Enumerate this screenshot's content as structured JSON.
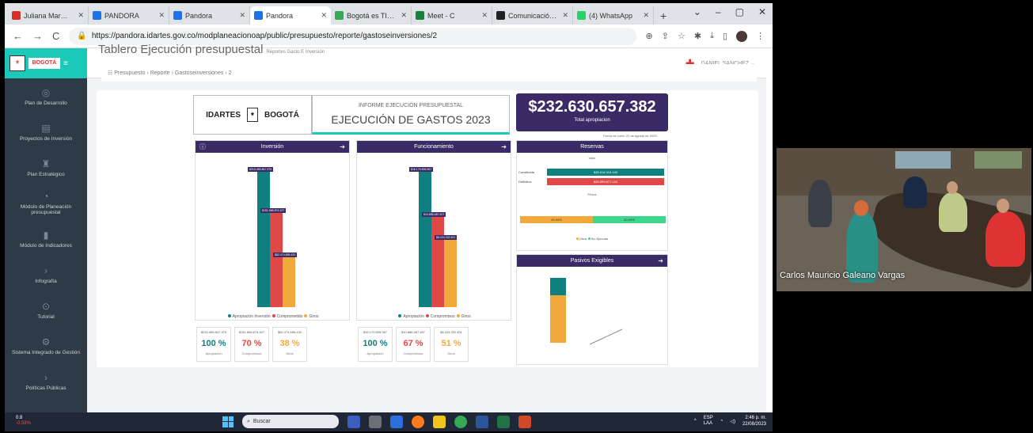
{
  "browser": {
    "tabs": [
      {
        "title": "Juliana Mar…",
        "color": "#d93025",
        "active": false
      },
      {
        "title": "PANDORA",
        "color": "#1a73e8",
        "active": false
      },
      {
        "title": "Pandora",
        "color": "#1a73e8",
        "active": false
      },
      {
        "title": "Pandora",
        "color": "#1a73e8",
        "active": true
      },
      {
        "title": "Bogotá es TI…",
        "color": "#34a853",
        "active": false
      },
      {
        "title": "Meet - C",
        "color": "#188038",
        "active": false
      },
      {
        "title": "Comunicació…",
        "color": "#202124",
        "active": false
      },
      {
        "title": "(4) WhatsApp",
        "color": "#25d366",
        "active": false
      }
    ],
    "new_tab": "+",
    "url": "https://pandora.idartes.gov.co/modplaneacionoap/public/presupuesto/reporte/gastoseinversiones/2",
    "win_controls": [
      "⌄",
      "–",
      "▢",
      "✕"
    ]
  },
  "app": {
    "logo_left": "BOGOTÁ",
    "user": "DANIEL SANCHEZ ⌄",
    "sidebar": [
      {
        "label": "Plan de Desarrollo",
        "icon": "◎"
      },
      {
        "label": "Proyectos de Inversión",
        "icon": "▤"
      },
      {
        "label": "Plan Estratégico",
        "icon": "♜"
      },
      {
        "label": "Módulo de Planeación presupuestal",
        "icon": "◔"
      },
      {
        "label": "Módulo de Indicadores",
        "icon": "▮"
      },
      {
        "label": "Infografía",
        "icon": "›"
      },
      {
        "label": "Tutorial",
        "icon": "⊙"
      },
      {
        "label": "Sistema Integrado de Gestión",
        "icon": "⚙"
      },
      {
        "label": "Políticas Públicas",
        "icon": "›"
      }
    ],
    "page_title": "Tablero Ejecución presupuestal",
    "page_subtitle": "Reportes Gasto E Inversión",
    "breadcrumb": "☷ Presupuesto  ›  Reporte  ›  Gastoseinversiones  ›  2"
  },
  "dashboard": {
    "logos": {
      "a": "IDARTES",
      "b": "BOGOTÁ"
    },
    "informe_small": "INFORME EJECUCIÓN PRESUPUESTAL",
    "informe_big": "EJECUCIÓN DE GASTOS 2023",
    "total_value": "$232.630.657.382",
    "total_label": "Total apropiacion",
    "date_note": "Fecha de corte: 22 de agosto de 2023",
    "panels": {
      "inversion": "Inversión",
      "funcionamiento": "Funcionamiento",
      "reservas": "Reservas",
      "pasivos": "Pasivos Exigibles"
    },
    "legend_inv": [
      "Apropiación Inversión",
      "Comprometido",
      "Giros"
    ],
    "legend_fun": [
      "Apropiación",
      "Compromisos",
      "Giros"
    ],
    "stats_inv": [
      {
        "amount": "$216.459.847.379",
        "pct": "100 %",
        "caption": "Apropiación",
        "color": "#0f7f7f"
      },
      {
        "amount": "$151.666.674.427",
        "pct": "70 %",
        "caption": "Compromisos",
        "color": "#e04848"
      },
      {
        "amount": "$82.474.656.432",
        "pct": "38 %",
        "caption": "Giros",
        "color": "#f2a93b"
      }
    ],
    "stats_fun": [
      {
        "amount": "$16.170.809.967",
        "pct": "100 %",
        "caption": "Apropiación",
        "color": "#0f7f7f"
      },
      {
        "amount": "$10.886.487.407",
        "pct": "67 %",
        "caption": "Compromisos",
        "color": "#e04848"
      },
      {
        "amount": "$8.224.292.401",
        "pct": "51 %",
        "caption": "Giros",
        "color": "#f2a93b"
      }
    ],
    "reservas_rows": [
      {
        "label": "Constituida",
        "value": "$28.816.316.440",
        "color": "#0f7f7f"
      },
      {
        "label": "Definitiva",
        "value": "$26.699.877.124",
        "color": "#e04848"
      }
    ],
    "reservas_top": "Valor",
    "reservas_mid": "Pesos",
    "reservas_split": {
      "left": "49.94%",
      "right": "50.06%"
    },
    "reservas_legend": [
      "Giros",
      "Sin Ejecutar"
    ]
  },
  "chart_data": [
    {
      "type": "bar",
      "title": "Inversión",
      "categories": [
        "Apropiación Inversión",
        "Comprometido",
        "Giros"
      ],
      "values": [
        216459847379,
        151666674427,
        82474656432
      ]
    },
    {
      "type": "bar",
      "title": "Funcionamiento",
      "categories": [
        "Apropiación",
        "Compromisos",
        "Giros"
      ],
      "values": [
        16170809967,
        10886487407,
        8224292401
      ]
    }
  ],
  "taskbar": {
    "weather_temp": "0.8",
    "weather_change": "-0,58%",
    "search": "Buscar",
    "lang": "ESP\nLAA",
    "time": "2:46 p. m.",
    "date": "22/08/2023"
  },
  "video": {
    "participant_name": "Carlos Mauricio Galeano Vargas"
  }
}
